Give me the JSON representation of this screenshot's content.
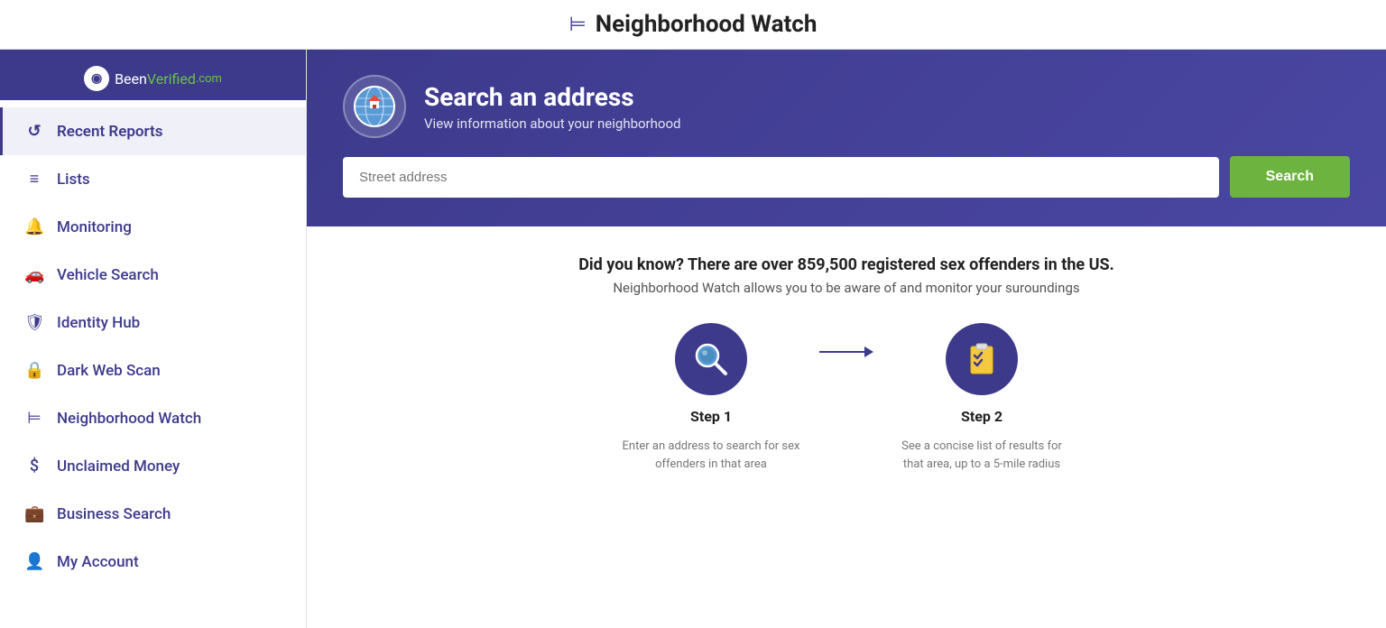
{
  "page": {
    "title": "Neighborhood Watch",
    "title_icon": "⊨"
  },
  "sidebar": {
    "logo": {
      "been": "Been",
      "verified": "Verified",
      "dot": ".com",
      "icon_char": "◉"
    },
    "items": [
      {
        "id": "recent-reports",
        "label": "Recent Reports",
        "icon": "↺",
        "active": true
      },
      {
        "id": "lists",
        "label": "Lists",
        "icon": "≡"
      },
      {
        "id": "monitoring",
        "label": "Monitoring",
        "icon": "🔔"
      },
      {
        "id": "vehicle-search",
        "label": "Vehicle Search",
        "icon": "🚗"
      },
      {
        "id": "identity-hub",
        "label": "Identity Hub",
        "icon": "🛡"
      },
      {
        "id": "dark-web-scan",
        "label": "Dark Web Scan",
        "icon": "🔒"
      },
      {
        "id": "neighborhood-watch",
        "label": "Neighborhood Watch",
        "icon": "⊨"
      },
      {
        "id": "unclaimed-money",
        "label": "Unclaimed Money",
        "icon": "$"
      },
      {
        "id": "business-search",
        "label": "Business Search",
        "icon": "💼"
      },
      {
        "id": "my-account",
        "label": "My Account",
        "icon": "👤"
      }
    ]
  },
  "hero": {
    "icon": "🌐",
    "title": "Search an address",
    "subtitle": "View information about your neighborhood",
    "search_placeholder": "Street address",
    "search_button": "Search"
  },
  "info": {
    "headline": "Did you know? There are over 859,500 registered sex offenders in the US.",
    "subtext": "Neighborhood Watch allows you to be aware of and monitor your suroundings",
    "steps": [
      {
        "id": "step-1",
        "icon": "🔍",
        "label": "Step 1",
        "description": "Enter an address to search for sex offenders in that area"
      },
      {
        "id": "step-2",
        "icon": "📋",
        "label": "Step 2",
        "description": "See a concise list of results for that area, up to a 5-mile radius"
      }
    ],
    "arrow": "→"
  }
}
